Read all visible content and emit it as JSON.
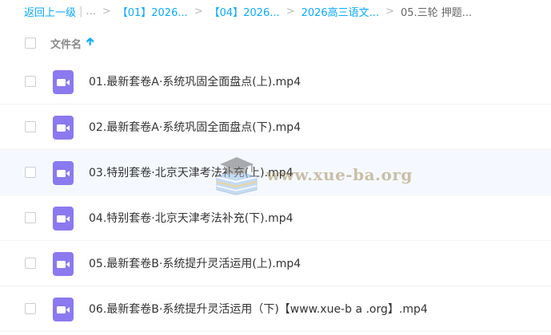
{
  "breadcrumb": {
    "back": "返回上一级",
    "ellipsis": "...",
    "items": [
      "【01】2026...",
      "【04】2026...",
      "2026高三语文...",
      "05.三轮 押题..."
    ],
    "link_color": "#09aaff"
  },
  "header": {
    "column_name": "文件名",
    "sort_icon": "arrow-up-icon"
  },
  "files": [
    {
      "name": "01.最新套卷A·系统巩固全面盘点(上).mp4",
      "icon": "video-file-icon"
    },
    {
      "name": "02.最新套卷A·系统巩固全面盘点(下).mp4",
      "icon": "video-file-icon"
    },
    {
      "name": "03.特别套卷·北京天津考法补充(上).mp4",
      "icon": "video-file-icon"
    },
    {
      "name": "04.特别套卷·北京天津考法补充(下).mp4",
      "icon": "video-file-icon"
    },
    {
      "name": "05.最新套卷B·系统提升灵活运用(上).mp4",
      "icon": "video-file-icon"
    },
    {
      "name": "06.最新套卷B·系统提升灵活运用（下)【www.xue-b a .org】.mp4",
      "icon": "video-file-icon"
    }
  ],
  "watermark": {
    "text": "www.xue-ba.org"
  },
  "colors": {
    "video_icon": "#8b79f0",
    "hover_row": "#f5f9ff"
  }
}
